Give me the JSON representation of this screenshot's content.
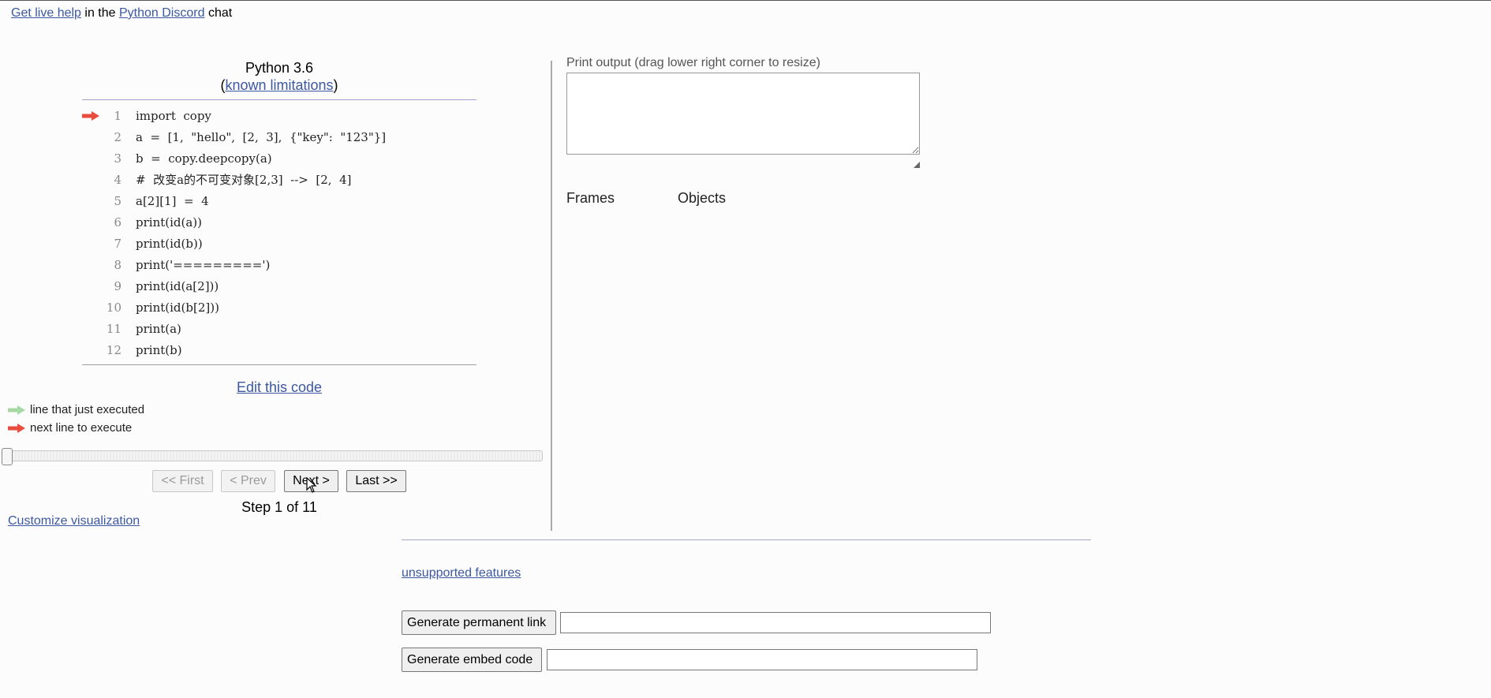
{
  "header": {
    "live_help_link": "Get live help",
    "in_the": "in the",
    "discord_link": "Python Discord",
    "chat": "chat"
  },
  "editor": {
    "python_version": "Python 3.6",
    "paren_open": "(",
    "limitations_link": "known limitations",
    "paren_close": ")",
    "current_line": 1,
    "lines": [
      {
        "num": "1",
        "code": "import  copy"
      },
      {
        "num": "2",
        "code": "a  =  [1,  \"hello\",  [2,  3],  {\"key\":  \"123\"}]"
      },
      {
        "num": "3",
        "code": "b  =  copy.deepcopy(a)"
      },
      {
        "num": "4",
        "code": "#  改变a的不可变对象[2,3]  -->  [2,  4]"
      },
      {
        "num": "5",
        "code": "a[2][1]  =  4"
      },
      {
        "num": "6",
        "code": "print(id(a))"
      },
      {
        "num": "7",
        "code": "print(id(b))"
      },
      {
        "num": "8",
        "code": "print('=========')"
      },
      {
        "num": "9",
        "code": "print(id(a[2]))"
      },
      {
        "num": "10",
        "code": "print(id(b[2]))"
      },
      {
        "num": "11",
        "code": "print(a)"
      },
      {
        "num": "12",
        "code": "print(b)"
      }
    ],
    "edit_link": "Edit this code"
  },
  "legend": {
    "executed": "line that just executed",
    "next": "next line to execute",
    "executed_color": "#a6d8a6",
    "next_color": "#e74c3c"
  },
  "navigation": {
    "first": "<< First",
    "prev": "< Prev",
    "next": "Next >",
    "last": "Last >>",
    "step_text": "Step 1 of 11",
    "slider_position": 0
  },
  "customize_link": "Customize visualization",
  "output": {
    "print_label": "Print output (drag lower right corner to resize)",
    "print_value": "",
    "frames_label": "Frames",
    "objects_label": "Objects"
  },
  "footer": {
    "unsupported_link": "unsupported features",
    "permalink_button": "Generate permanent link",
    "permalink_value": "",
    "embed_button": "Generate embed code",
    "embed_value": ""
  }
}
